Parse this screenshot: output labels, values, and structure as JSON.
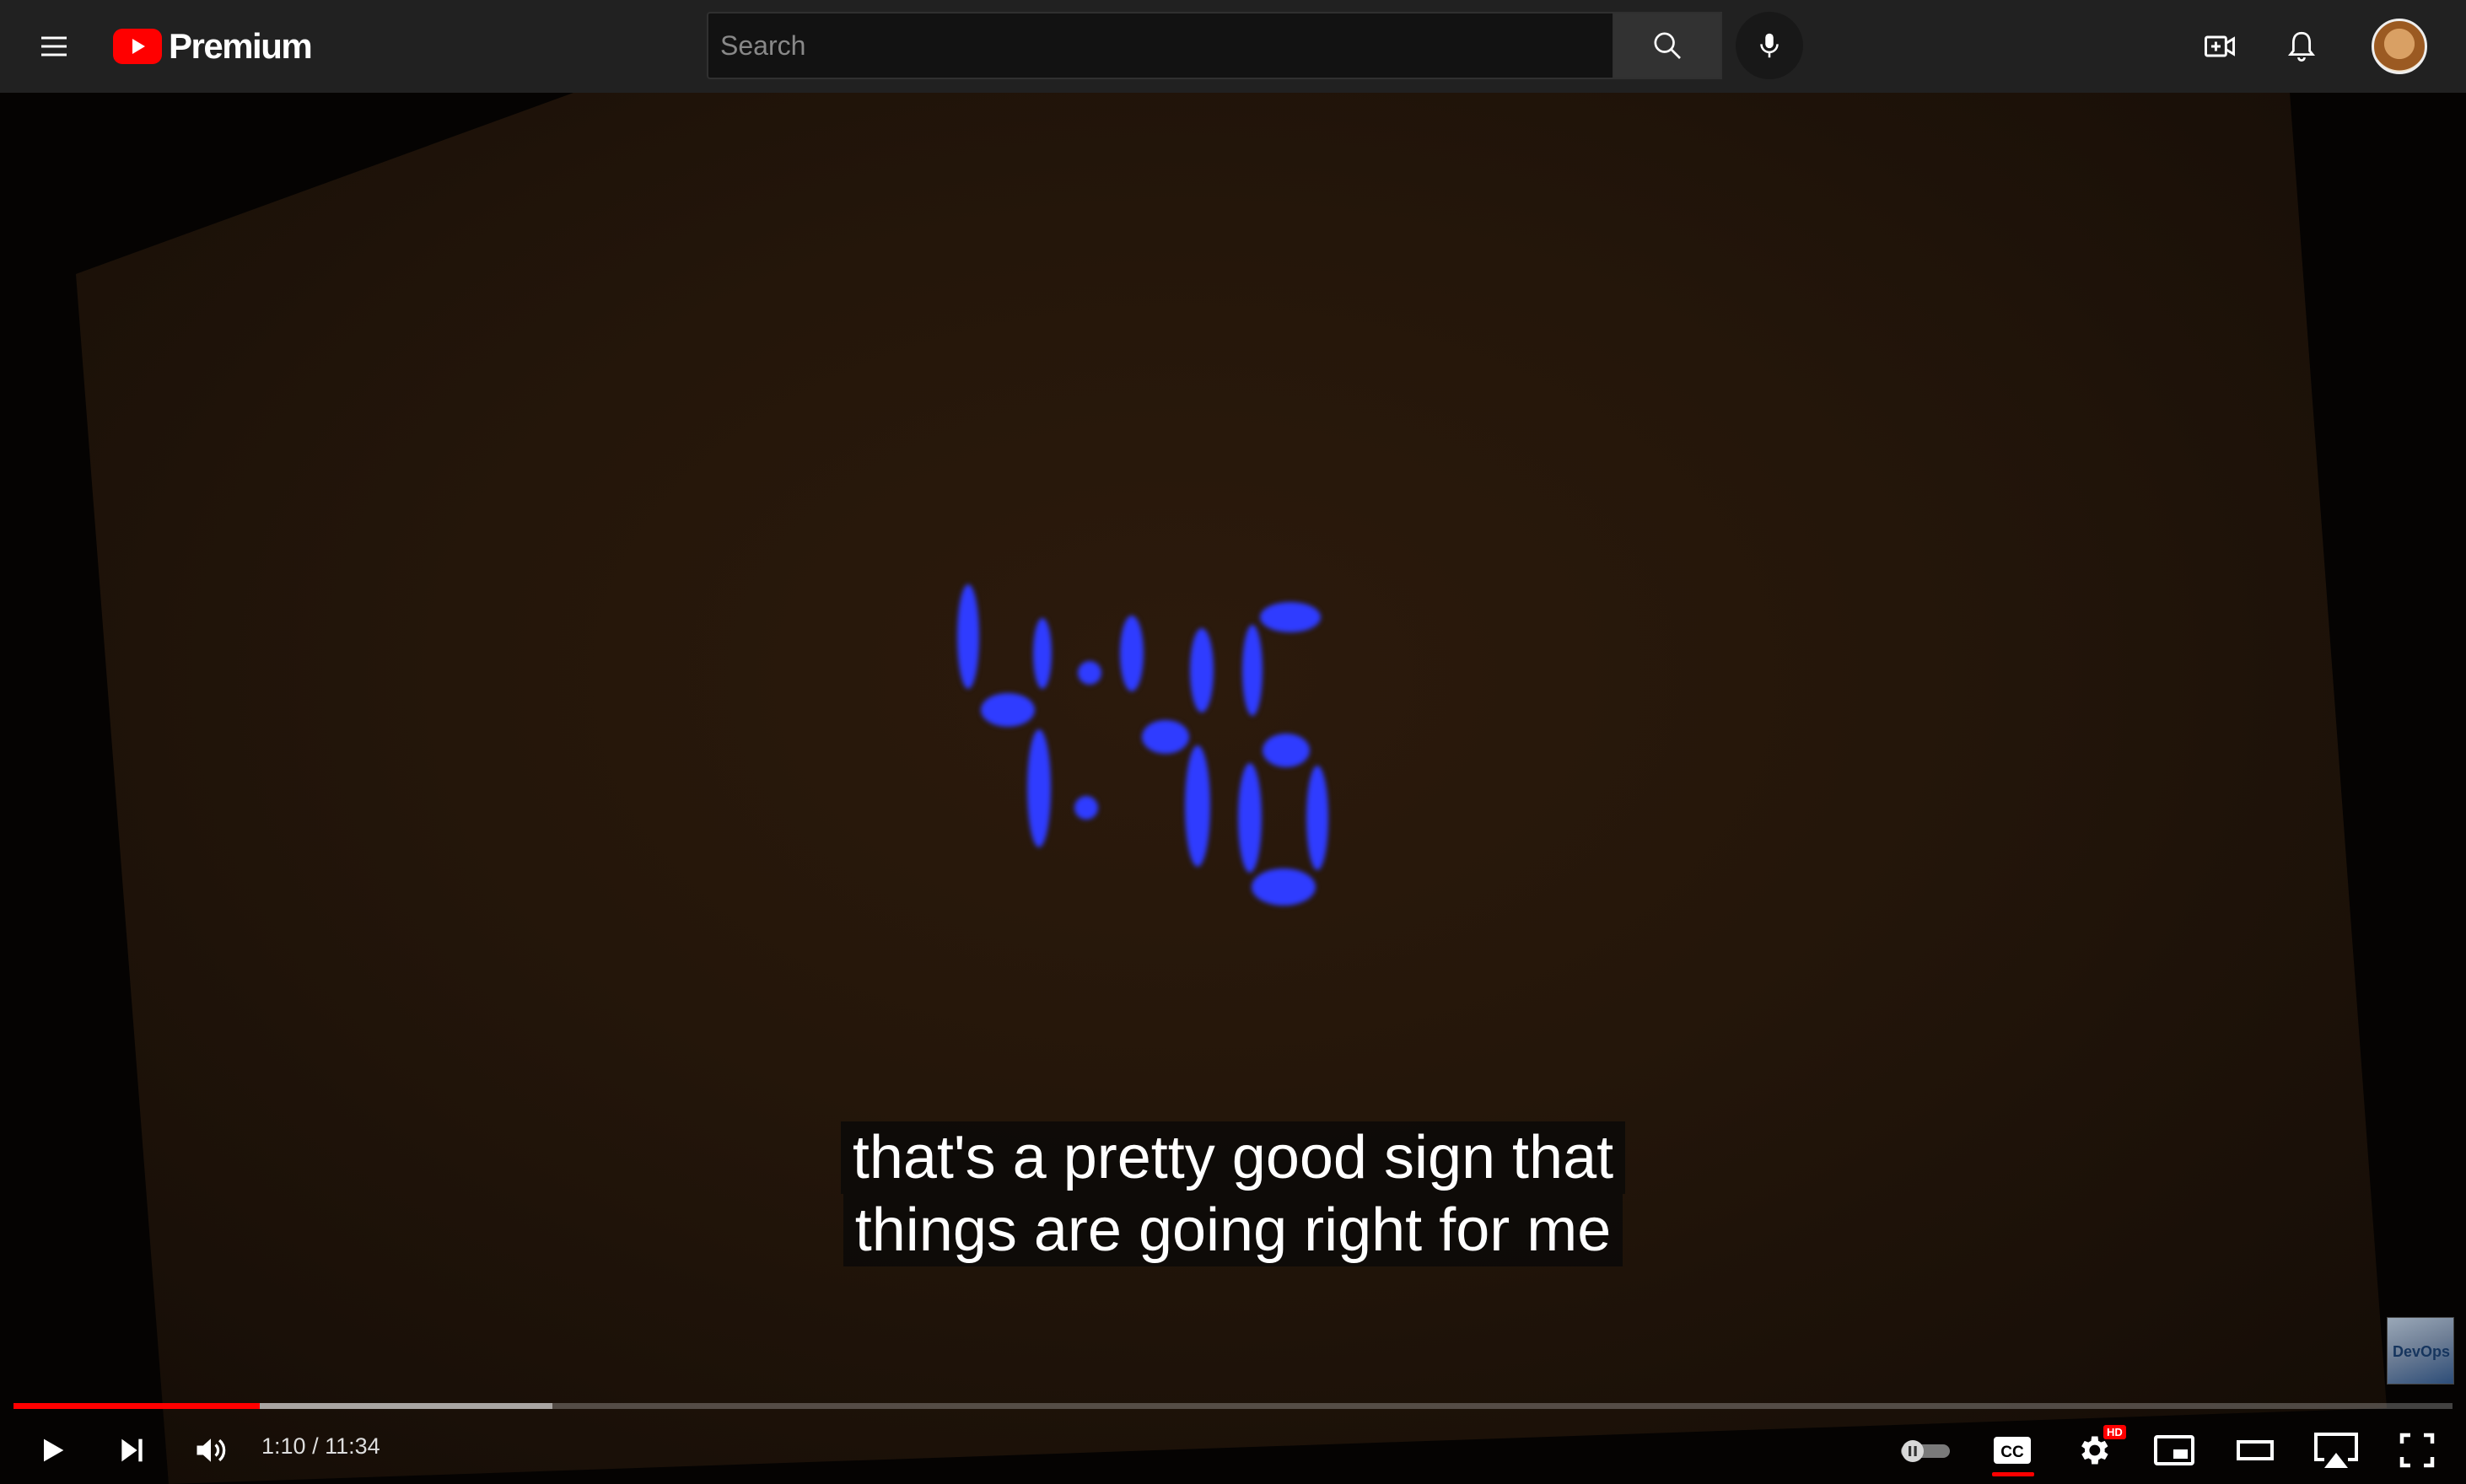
{
  "header": {
    "logo_text": "Premium",
    "search_placeholder": "Search"
  },
  "video": {
    "subtitle_lines": [
      "that's a pretty good sign that",
      "things are going right for me"
    ],
    "channel_watermark": "DevOps"
  },
  "player": {
    "time_current": "1:10",
    "time_separator": " / ",
    "time_total": "11:34",
    "progress_played": 0.101,
    "progress_buffered": 0.221,
    "settings_badge": "HD"
  },
  "colors": {
    "accent": "#ff0000",
    "masthead": "#212121",
    "clock_digits": "#2f3cff"
  },
  "icons": [
    "menu-icon",
    "youtube-logo-icon",
    "search-icon",
    "mic-icon",
    "create-video-icon",
    "bell-icon",
    "play-icon",
    "next-icon",
    "volume-icon",
    "autoplay-toggle-icon",
    "cc-icon",
    "settings-icon",
    "miniplayer-icon",
    "theater-icon",
    "airplay-icon",
    "fullscreen-icon"
  ]
}
